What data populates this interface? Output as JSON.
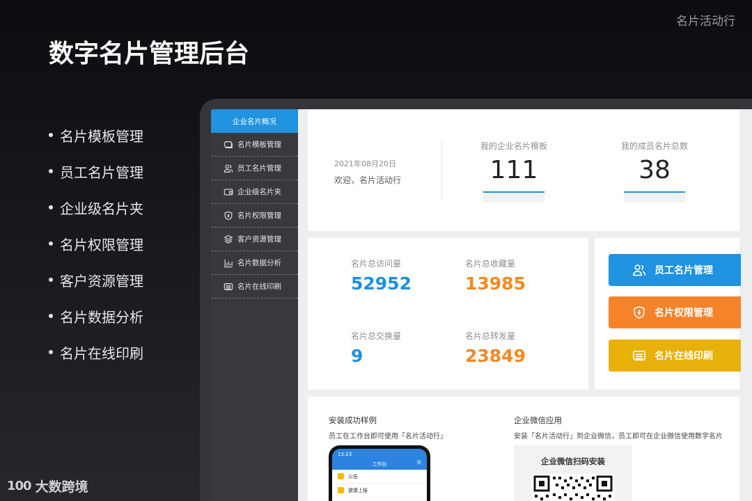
{
  "header": {
    "brand": "名片活动行",
    "title": "数字名片管理后台"
  },
  "features": [
    "名片模板管理",
    "员工名片管理",
    "企业级名片夹",
    "名片权限管理",
    "客户资源管理",
    "名片数据分析",
    "名片在线印刷"
  ],
  "footer": {
    "mark": "100",
    "brand": "大数跨境"
  },
  "app": {
    "sidebar": {
      "active": "企业名片概况",
      "items": [
        {
          "label": "名片模板管理",
          "icon": "card-template-icon"
        },
        {
          "label": "员工名片管理",
          "icon": "users-icon"
        },
        {
          "label": "企业级名片夹",
          "icon": "wallet-icon"
        },
        {
          "label": "名片权限管理",
          "icon": "shield-icon"
        },
        {
          "label": "客户资源管理",
          "icon": "layers-icon"
        },
        {
          "label": "名片数据分析",
          "icon": "bar-chart-icon"
        },
        {
          "label": "名片在线印刷",
          "icon": "printer-icon"
        }
      ]
    },
    "overview": {
      "date": "2021年08月20日",
      "welcome": "欢迎，名片活动行",
      "metrics": [
        {
          "label": "我的企业名片模板",
          "value": "111"
        },
        {
          "label": "我的成员名片总数",
          "value": "38"
        }
      ]
    },
    "stats": [
      {
        "label": "名片总访问量",
        "value": "52952",
        "color": "#1f8fdd"
      },
      {
        "label": "名片总收藏量",
        "value": "13985",
        "color": "#f08a24"
      },
      {
        "label": "名片总交换量",
        "value": "9",
        "color": "#1f8fdd"
      },
      {
        "label": "名片总转发量",
        "value": "23849",
        "color": "#f08a24"
      }
    ],
    "actions": [
      {
        "label": "员工名片管理",
        "color": "#1f92e0",
        "icon": "users-icon"
      },
      {
        "label": "名片权限管理",
        "color": "#f5832a",
        "icon": "shield-icon"
      },
      {
        "label": "名片在线印刷",
        "color": "#e8b00b",
        "icon": "printer-icon"
      }
    ],
    "install": {
      "title": "安装成功样例",
      "desc": "员工在工作台即可使用「名片活动行」",
      "phone": {
        "time": "13:23",
        "header": "工作台",
        "rows": [
          "公告",
          "健康上报"
        ]
      }
    },
    "wecom": {
      "title": "企业微信应用",
      "desc": "安装「名片活动行」到企业微信，员工即可在企业微信使用数字名片",
      "qr_title": "企业微信扫码安装"
    }
  }
}
